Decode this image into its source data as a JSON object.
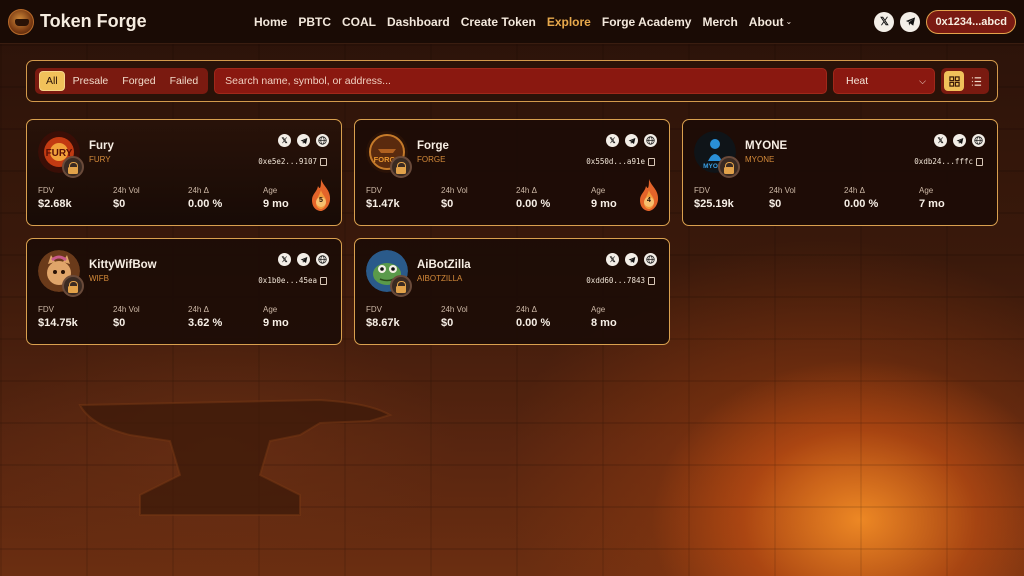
{
  "nav": {
    "brand": "Token Forge",
    "items": [
      "Home",
      "PBTC",
      "COAL",
      "Dashboard",
      "Create Token",
      "Explore",
      "Forge Academy",
      "Merch",
      "About"
    ],
    "active": "Explore",
    "wallet": "0x1234...abcd",
    "social_icons": [
      "x-icon",
      "telegram-icon"
    ]
  },
  "filters": {
    "tabs": [
      "All",
      "Presale",
      "Forged",
      "Failed"
    ],
    "active_tab": "All",
    "search_placeholder": "Search name, symbol, or address...",
    "sort_value": "Heat",
    "view_modes": [
      "grid-icon",
      "list-icon"
    ],
    "active_view": "grid-icon"
  },
  "stat_labels": {
    "fdv": "FDV",
    "vol": "24h Vol",
    "change": "24h Δ",
    "age": "Age"
  },
  "tokens": [
    {
      "name": "Fury",
      "symbol": "FURY",
      "address": "0xe5e2...9107",
      "fdv": "$2.68k",
      "vol": "$0",
      "change": "0.00 %",
      "age": "9 mo",
      "heat": "5"
    },
    {
      "name": "Forge",
      "symbol": "FORGE",
      "address": "0x550d...a91e",
      "fdv": "$1.47k",
      "vol": "$0",
      "change": "0.00 %",
      "age": "9 mo",
      "heat": "4"
    },
    {
      "name": "MYONE",
      "symbol": "MYONE",
      "address": "0xdb24...fffc",
      "fdv": "$25.19k",
      "vol": "$0",
      "change": "0.00 %",
      "age": "7 mo"
    },
    {
      "name": "KittyWifBow",
      "symbol": "WIFB",
      "address": "0x1b0e...45ea",
      "fdv": "$14.75k",
      "vol": "$0",
      "change": "3.62 %",
      "age": "9 mo"
    },
    {
      "name": "AiBotZilla",
      "symbol": "AIBOTZILLA",
      "address": "0xdd60...7843",
      "fdv": "$8.67k",
      "vol": "$0",
      "change": "0.00 %",
      "age": "8 mo"
    }
  ],
  "colors": {
    "accent": "#e8a94c",
    "card_border": "#d9a04f",
    "search_bg": "#8a1810",
    "wallet_bg": "#7a1a12"
  }
}
